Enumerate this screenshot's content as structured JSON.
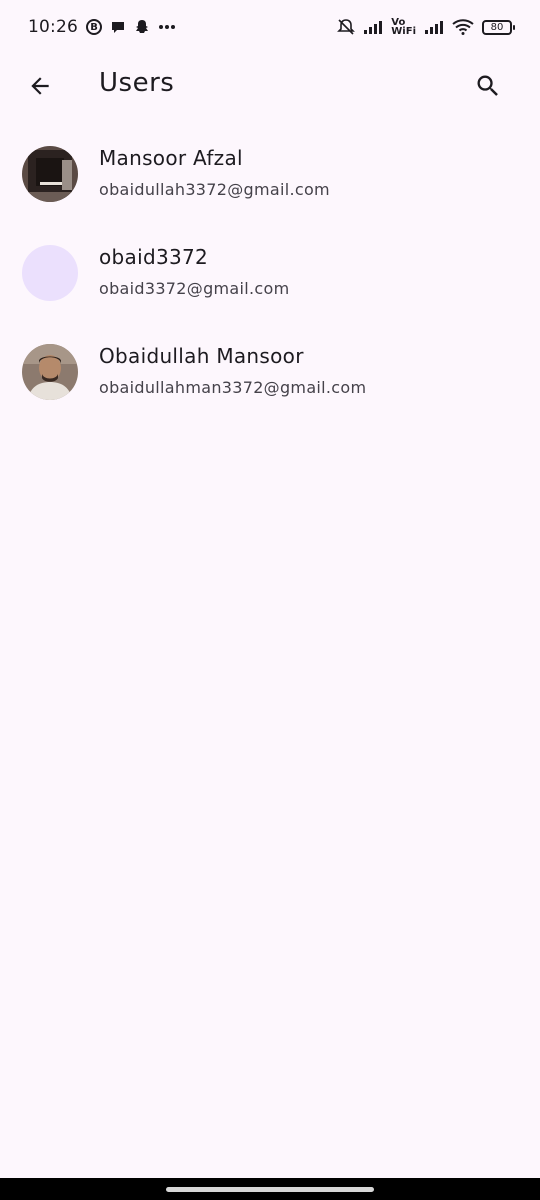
{
  "status_bar": {
    "time": "10:26",
    "b_badge": "B",
    "vo_label": "Vo",
    "wifi_label": "WiFi",
    "battery": "80"
  },
  "app_bar": {
    "title": "Users"
  },
  "users": [
    {
      "name": "Mansoor Afzal",
      "email": "obaidullah3372@gmail.com"
    },
    {
      "name": "obaid3372",
      "email": "obaid3372@gmail.com"
    },
    {
      "name": "Obaidullah Mansoor",
      "email": "obaidullahman3372@gmail.com"
    }
  ],
  "colors": {
    "background": "#fdf7fd",
    "avatar_placeholder": "#ebe0fd",
    "text_primary": "#1d1b20",
    "text_secondary": "#45424a"
  }
}
